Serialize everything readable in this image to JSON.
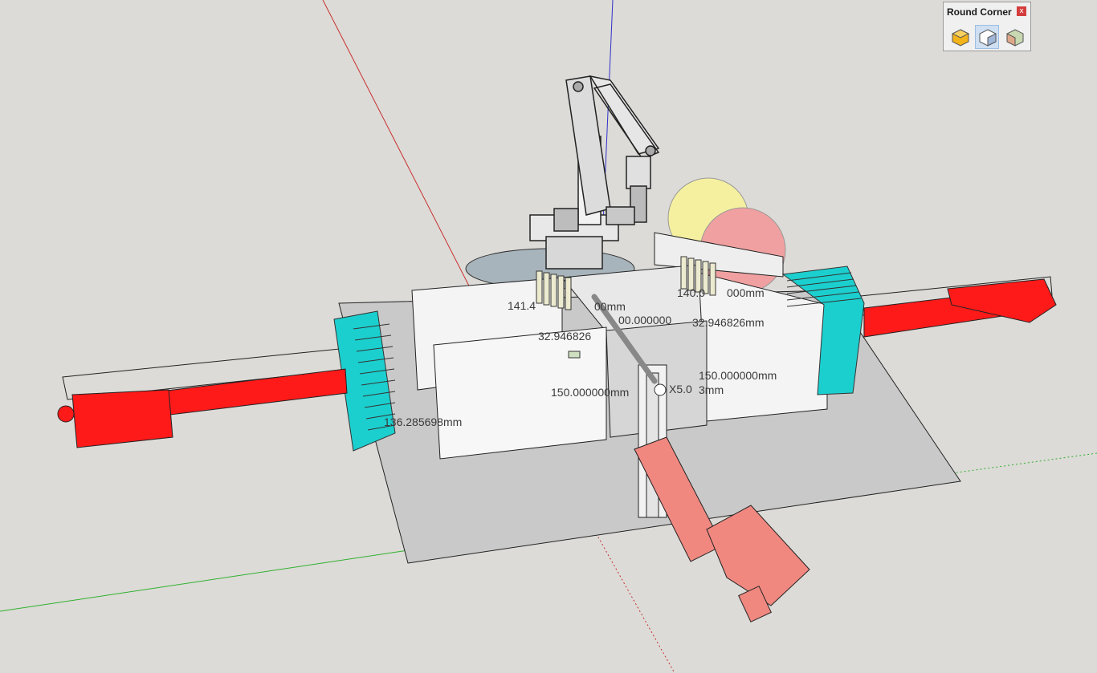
{
  "toolbar": {
    "title": "Round Corner",
    "close": "x",
    "tools": [
      {
        "name": "round-corner-tool",
        "icon": "round-corner-icon"
      },
      {
        "name": "sharp-corner-tool",
        "icon": "sharp-corner-icon",
        "selected": true
      },
      {
        "name": "bevel-tool",
        "icon": "bevel-icon"
      }
    ]
  },
  "dimensions": {
    "d1": "141.4",
    "d1b": "00mm",
    "d2": "140.0",
    "d2b": "000mm",
    "d3": "00.000000",
    "d4": "32.946826",
    "d5": "32.946826mm",
    "d6": "150.000000mm",
    "d7": "150.000000mm",
    "d8": "136.285698mm",
    "d9": "X5.0",
    "d9b": "3mm"
  },
  "colors": {
    "background": "#dcdbd7",
    "actuator_red": "#ff1a1a",
    "actuator_pink": "#f08880",
    "heatsink_cyan": "#1ccfcf",
    "ball_yellow": "#f5f0a0",
    "ball_pink": "#f0a0a0",
    "axis_red": "#c83030",
    "axis_green": "#30b030",
    "axis_blue": "#3030c8"
  }
}
